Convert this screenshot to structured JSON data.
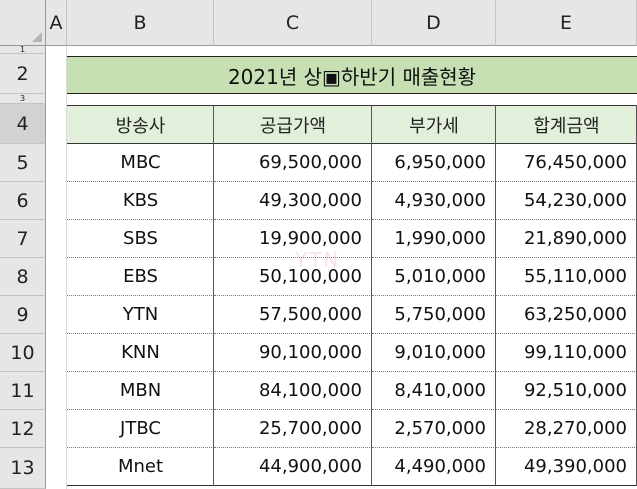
{
  "column_headers": [
    "A",
    "B",
    "C",
    "D",
    "E"
  ],
  "row_headers": [
    "1",
    "2",
    "3",
    "4",
    "5",
    "6",
    "7",
    "8",
    "9",
    "10",
    "11",
    "12",
    "13"
  ],
  "title": "2021년 상▣하반기 매출현황",
  "table": {
    "headers": [
      "방송사",
      "공급가액",
      "부가세",
      "합계금액"
    ],
    "rows": [
      {
        "station": "MBC",
        "supply": "69,500,000",
        "vat": "6,950,000",
        "total": "76,450,000"
      },
      {
        "station": "KBS",
        "supply": "49,300,000",
        "vat": "4,930,000",
        "total": "54,230,000"
      },
      {
        "station": "SBS",
        "supply": "19,900,000",
        "vat": "1,990,000",
        "total": "21,890,000"
      },
      {
        "station": "EBS",
        "supply": "50,100,000",
        "vat": "5,010,000",
        "total": "55,110,000"
      },
      {
        "station": "YTN",
        "supply": "57,500,000",
        "vat": "5,750,000",
        "total": "63,250,000"
      },
      {
        "station": "KNN",
        "supply": "90,100,000",
        "vat": "9,010,000",
        "total": "99,110,000"
      },
      {
        "station": "MBN",
        "supply": "84,100,000",
        "vat": "8,410,000",
        "total": "92,510,000"
      },
      {
        "station": "JTBC",
        "supply": "25,700,000",
        "vat": "2,570,000",
        "total": "28,270,000"
      },
      {
        "station": "Mnet",
        "supply": "44,900,000",
        "vat": "4,490,000",
        "total": "49,390,000"
      }
    ]
  },
  "watermark": "YTN",
  "colors": {
    "title_fill": "#c6e0b4",
    "header_fill": "#e2efda",
    "selected_header": "#d2d2d2"
  }
}
